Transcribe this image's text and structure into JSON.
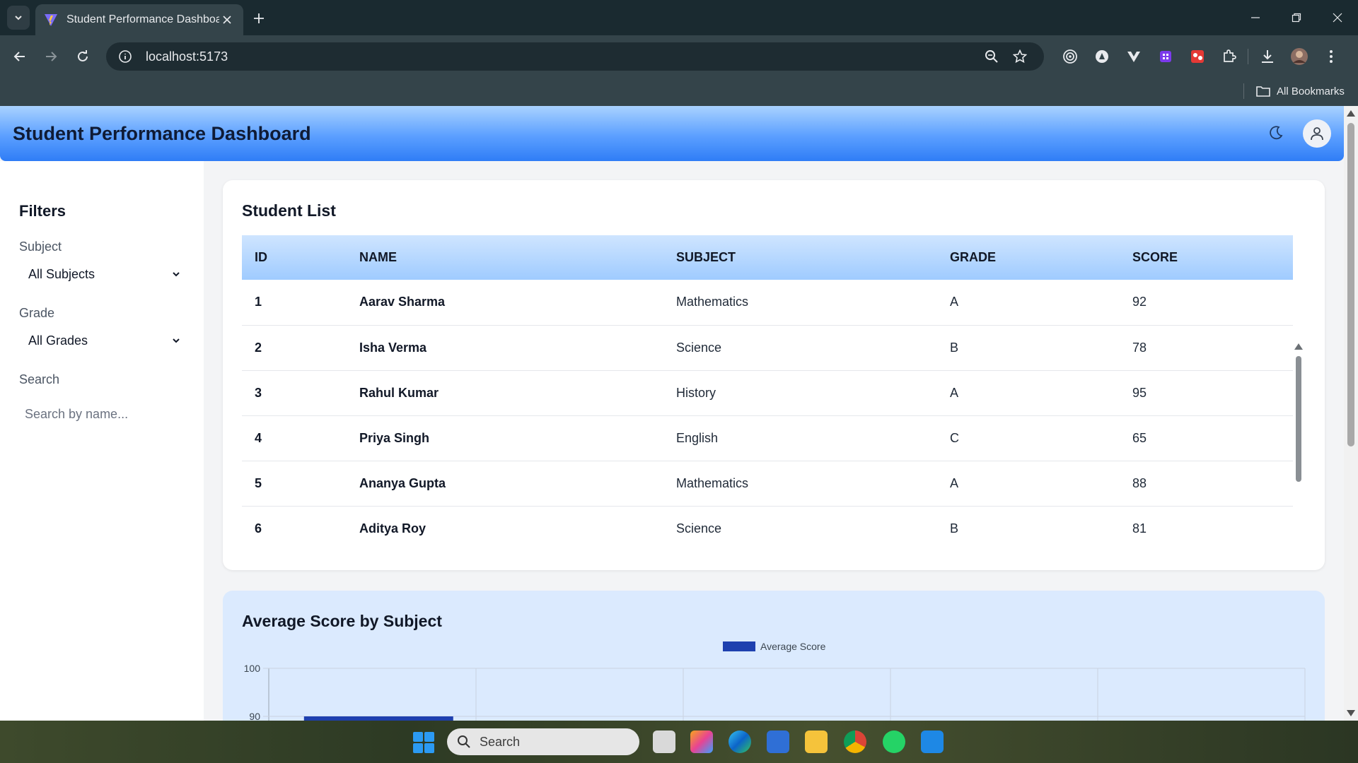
{
  "browser": {
    "tab_title": "Student Performance Dashboard",
    "url": "localhost:5173",
    "bookmarks_label": "All Bookmarks"
  },
  "app": {
    "title": "Student Performance Dashboard"
  },
  "filters": {
    "title": "Filters",
    "subject_label": "Subject",
    "subject_value": "All Subjects",
    "grade_label": "Grade",
    "grade_value": "All Grades",
    "search_label": "Search",
    "search_placeholder": "Search by name..."
  },
  "student_list": {
    "title": "Student List",
    "columns": [
      "ID",
      "NAME",
      "SUBJECT",
      "GRADE",
      "SCORE"
    ],
    "rows": [
      [
        "1",
        "Aarav Sharma",
        "Mathematics",
        "A",
        "92"
      ],
      [
        "2",
        "Isha Verma",
        "Science",
        "B",
        "78"
      ],
      [
        "3",
        "Rahul Kumar",
        "History",
        "A",
        "95"
      ],
      [
        "4",
        "Priya Singh",
        "English",
        "C",
        "65"
      ],
      [
        "5",
        "Ananya Gupta",
        "Mathematics",
        "A",
        "88"
      ],
      [
        "6",
        "Aditya Roy",
        "Science",
        "B",
        "81"
      ]
    ]
  },
  "avg_chart": {
    "title": "Average Score by Subject",
    "legend": "Average Score",
    "bar_color": "#1e40af",
    "y_ticks": [
      "100",
      "90"
    ]
  },
  "chart_data": {
    "type": "bar",
    "title": "Average Score by Subject",
    "series": [
      {
        "name": "Average Score",
        "values": [
          90
        ]
      }
    ],
    "ylim": [
      90,
      100
    ],
    "y_ticks": [
      100,
      90
    ],
    "category_count": 5,
    "grid": true,
    "legend_position": "top"
  },
  "taskbar": {
    "search_placeholder": "Search"
  },
  "icons": {
    "accent": "#3b82f6"
  }
}
